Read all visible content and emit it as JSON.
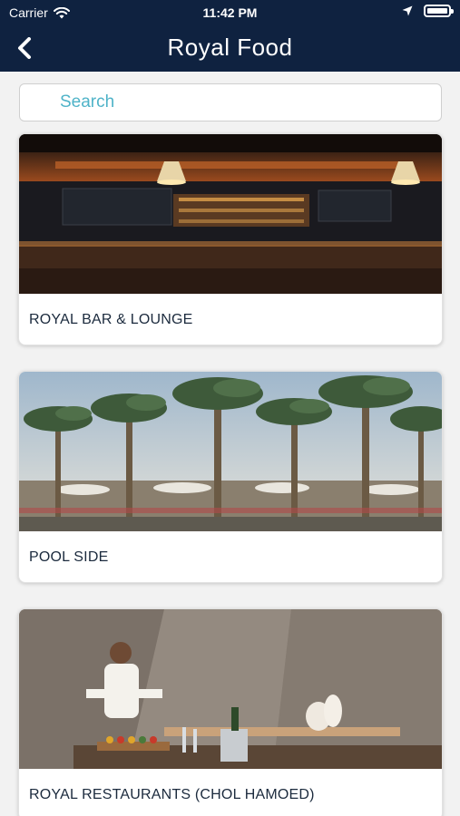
{
  "status_bar": {
    "carrier": "Carrier",
    "time": "11:42 PM"
  },
  "nav": {
    "title": "Royal Food",
    "back_icon": "chevron-left-icon"
  },
  "search": {
    "placeholder": "Search"
  },
  "cards": [
    {
      "label": "ROYAL BAR & LOUNGE"
    },
    {
      "label": "POOL SIDE"
    },
    {
      "label": "ROYAL RESTAURANTS (CHOL HAMOED)"
    }
  ],
  "colors": {
    "nav_bg": "#0f2240",
    "search_placeholder": "#4fb3c8",
    "card_text": "#1b2a3d"
  }
}
